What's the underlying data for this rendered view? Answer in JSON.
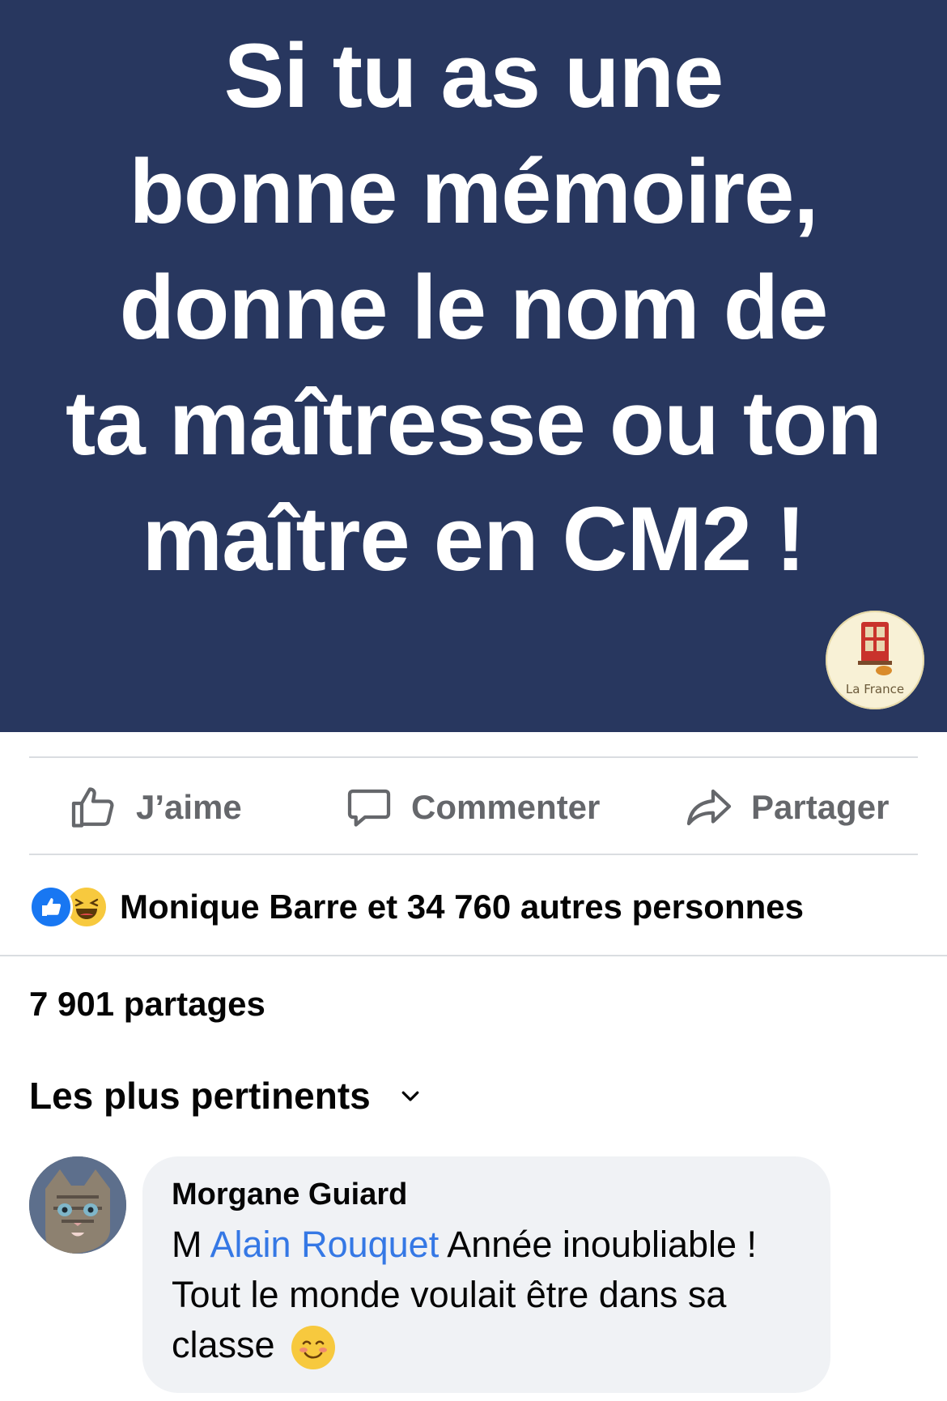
{
  "post": {
    "image_text_lines": [
      "Si tu as une",
      "bonne mémoire,",
      "donne le nom de",
      "ta maîtresse ou ton",
      "maître en CM2 !"
    ],
    "logo_text": "La France",
    "background_color": "#28375f"
  },
  "actions": {
    "like_label": "J’aime",
    "comment_label": "Commenter",
    "share_label": "Partager"
  },
  "reactions": {
    "summary": "Monique Barre et 34 760 autres personnes",
    "icons": [
      "like-reaction-icon",
      "haha-reaction-icon"
    ]
  },
  "shares": {
    "label": "7 901 partages"
  },
  "comments": {
    "sort_label": "Les plus pertinents",
    "items": [
      {
        "author": "Morgane Guiard",
        "prefix": "M ",
        "mention": "Alain Rouquet",
        "text": " Année inoubliable ! Tout le monde voulait être dans sa classe",
        "emoji": "smiling-face-emoji"
      }
    ]
  },
  "colors": {
    "accent": "#1877f2",
    "mention": "#3578e5",
    "muted_text": "#65676b",
    "divider": "#dadde1",
    "comment_bubble": "#f0f2f5"
  }
}
